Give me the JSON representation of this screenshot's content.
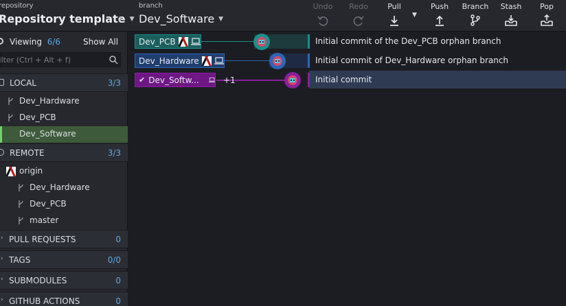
{
  "header": {
    "repo_small": "repository",
    "repo_name": "Repository template",
    "branch_small": "branch",
    "branch_name": "Dev_Software",
    "tools": [
      {
        "label": "Undo",
        "enabled": false,
        "icon": "undo-icon"
      },
      {
        "label": "Redo",
        "enabled": false,
        "icon": "redo-icon"
      },
      {
        "label": "Pull",
        "enabled": true,
        "icon": "pull-icon"
      },
      {
        "label": "Push",
        "enabled": true,
        "icon": "push-icon"
      },
      {
        "label": "Branch",
        "enabled": true,
        "icon": "branch-icon"
      },
      {
        "label": "Stash",
        "enabled": true,
        "icon": "stash-icon"
      },
      {
        "label": "Pop",
        "enabled": true,
        "icon": "pop-icon"
      }
    ]
  },
  "sidebar": {
    "viewing_label": "Viewing",
    "viewing_count": "6/6",
    "show_all": "Show All",
    "filter_placeholder": "Filter (Ctrl + Alt + f)",
    "local": {
      "title": "LOCAL",
      "count": "3/3",
      "items": [
        "Dev_Hardware",
        "Dev_PCB",
        "Dev_Software"
      ],
      "active": "Dev_Software"
    },
    "remote": {
      "title": "REMOTE",
      "count": "3/3",
      "remote_name": "origin",
      "items": [
        "Dev_Hardware",
        "Dev_PCB",
        "master"
      ]
    },
    "pull_requests": {
      "title": "PULL REQUESTS",
      "count": "0"
    },
    "tags": {
      "title": "TAGS",
      "count": "0/0"
    },
    "submodules": {
      "title": "SUBMODULES",
      "count": "0"
    },
    "github_actions": {
      "title": "GITHUB ACTIONS",
      "count": "0"
    }
  },
  "graph": {
    "rows": [
      {
        "branch": "Dev_PCB",
        "message": "Initial commit of the Dev_PCB orphan branch",
        "color": "#1a8f8c",
        "checked": false
      },
      {
        "branch": "Dev_Hardware",
        "message": "Initial commit of Dev_Hardware orphan branch",
        "color": "#2f65b8",
        "checked": false
      },
      {
        "branch": "Dev_Softw...",
        "message": "Initial commit",
        "color": "#8a1fa0",
        "checked": true,
        "extra": "+1"
      }
    ]
  },
  "colors": {
    "accent": "#5aa9e6",
    "active_branch": "#3d5a3a",
    "selected_row": "#2f3b53"
  }
}
